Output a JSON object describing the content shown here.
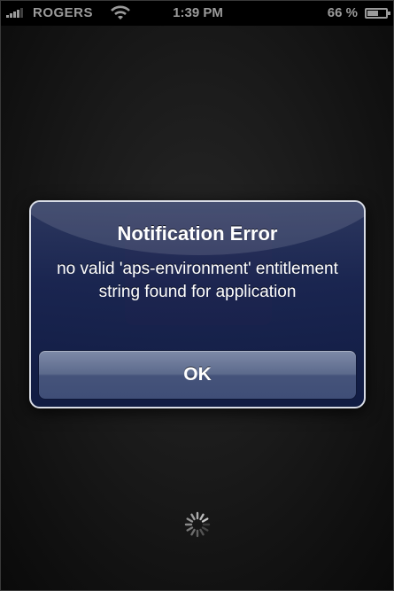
{
  "status_bar": {
    "carrier": "ROGERS",
    "time": "1:39 PM",
    "battery_percent": "66 %",
    "battery_level": 0.66
  },
  "alert": {
    "title": "Notification Error",
    "message": "no valid 'aps-environment' entitlement string found for application",
    "ok_label": "OK"
  },
  "icons": {
    "signal": "signal-strength-icon",
    "wifi": "wifi-icon",
    "battery": "battery-icon",
    "spinner": "loading-spinner-icon"
  }
}
